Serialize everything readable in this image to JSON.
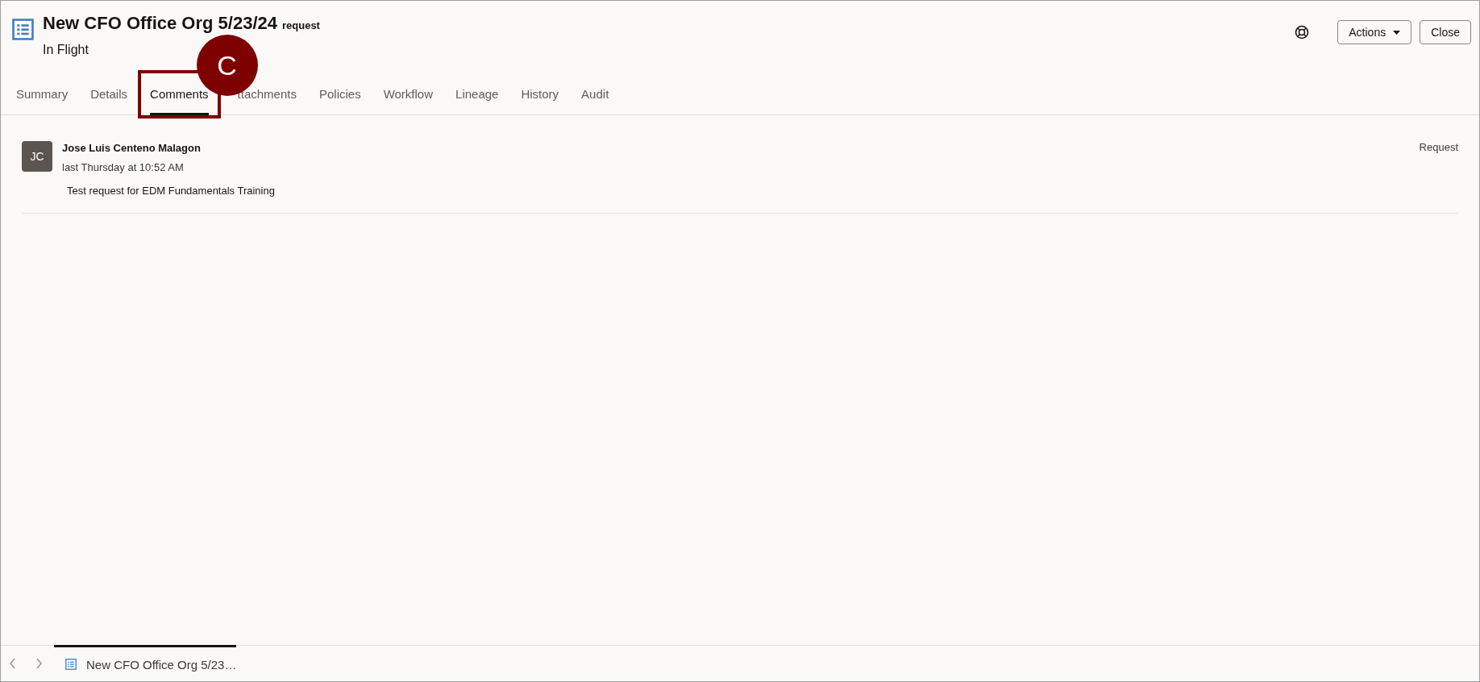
{
  "header": {
    "title": "New CFO Office Org 5/23/24",
    "type": "request",
    "status": "In Flight",
    "buttons": [
      {
        "label": "Actions",
        "kind": "menu"
      },
      {
        "label": "Close",
        "kind": "plain"
      }
    ]
  },
  "tabs": [
    {
      "label": "Summary",
      "selected": false
    },
    {
      "label": "Details",
      "selected": false
    },
    {
      "label": "Comments",
      "selected": true
    },
    {
      "label": "ttachments",
      "selected": false
    },
    {
      "label": "Policies",
      "selected": false
    },
    {
      "label": "Workflow",
      "selected": false
    },
    {
      "label": "Lineage",
      "selected": false
    },
    {
      "label": "History",
      "selected": false
    },
    {
      "label": "Audit",
      "selected": false
    }
  ],
  "callout": {
    "label": "C"
  },
  "comments": [
    {
      "initials": "JC",
      "author": "Jose Luis Centeno Malagon",
      "time": "last Thursday at 10:52 AM",
      "text": "Test request for EDM Fundamentals Training",
      "category": "Request"
    }
  ],
  "bottom_bar": {
    "tabs": [
      {
        "label": "New CFO Office Org 5/23…",
        "selected": true
      }
    ]
  }
}
